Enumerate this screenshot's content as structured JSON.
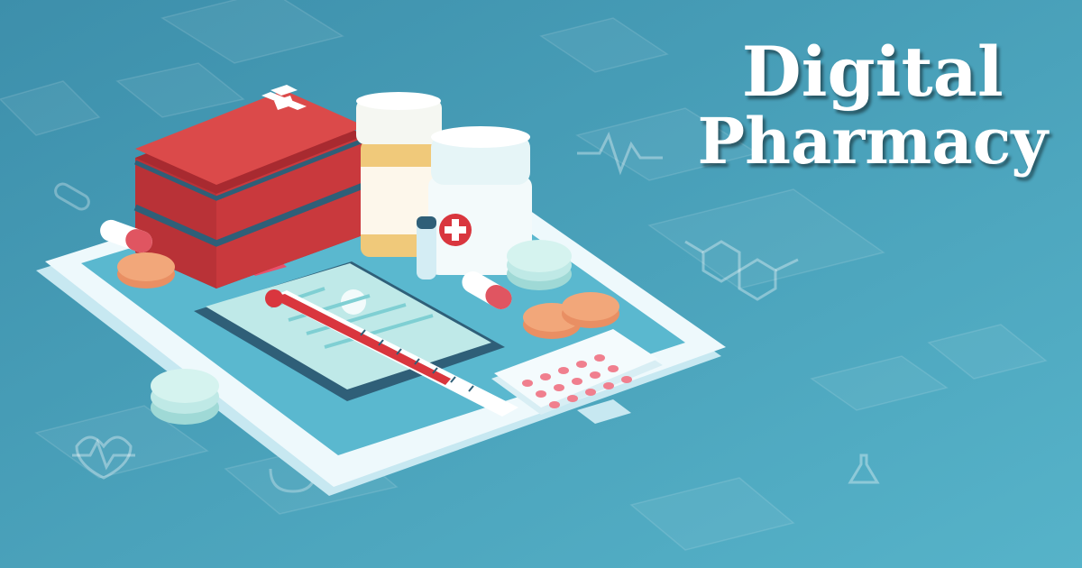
{
  "headline": {
    "line1": "Digital",
    "line2": "Pharmacy"
  },
  "colors": {
    "background": "#3f9fb7",
    "phone_body": "#e8f6fb",
    "phone_screen": "#5ab8cf",
    "first_aid_kit": "#cf3b3b",
    "pill_bottle_cap": "#f5f7f2",
    "pill_bottle_body": "#f0c97a",
    "tablet_orange": "#f2a77a",
    "capsule_red": "#e05561",
    "thermometer_red": "#d9363e",
    "title_text": "#ffffff"
  },
  "illustration": {
    "items": [
      "first-aid-kit",
      "pill-bottle",
      "medicine-jar",
      "clipboard",
      "thermometer",
      "blister-pack",
      "capsules",
      "tablets",
      "smartphone"
    ],
    "background_icons": [
      "heartbeat-icon",
      "molecule-icon",
      "stethoscope-icon",
      "flask-icon",
      "capsule-icon",
      "ecg-icon"
    ]
  }
}
